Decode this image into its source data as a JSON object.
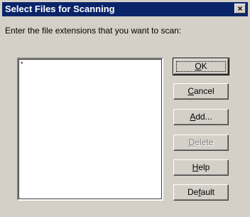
{
  "dialog": {
    "title": "Select Files for Scanning",
    "close_glyph": "×",
    "prompt": "Enter the file extensions that you want to scan:"
  },
  "extensions_list": {
    "items": [
      "*"
    ]
  },
  "buttons": {
    "ok": {
      "mnemonic": "O",
      "rest": "K"
    },
    "cancel": {
      "mnemonic": "C",
      "rest": "ancel"
    },
    "add": {
      "mnemonic": "A",
      "rest": "dd..."
    },
    "delete": {
      "mnemonic": "D",
      "rest": "elete",
      "disabled": true
    },
    "help": {
      "mnemonic": "H",
      "rest": "elp"
    },
    "default": {
      "pre": "De",
      "mnemonic": "f",
      "rest": "ault"
    }
  },
  "colors": {
    "titlebar": "#0a246a",
    "face": "#d4d0c8"
  },
  "icons": {
    "close": "close-icon"
  }
}
